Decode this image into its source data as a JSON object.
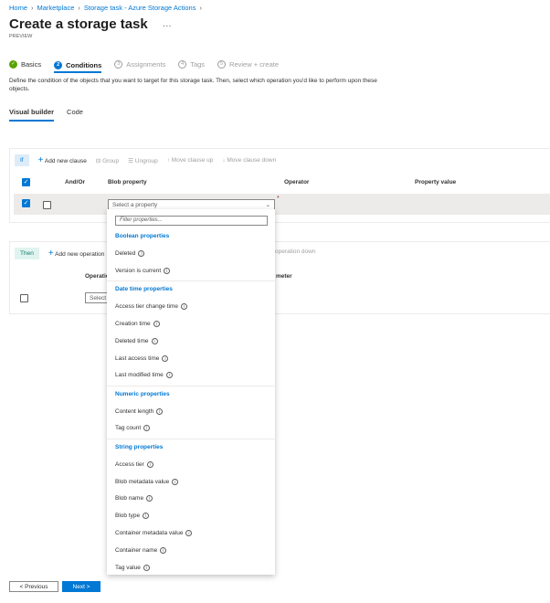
{
  "breadcrumb": [
    "Home",
    "Marketplace",
    "Storage task - Azure Storage Actions"
  ],
  "title": "Create a storage task",
  "more": "···",
  "preview": "PREVIEW",
  "steps": [
    {
      "n": "✓",
      "label": "Basics"
    },
    {
      "n": "2",
      "label": "Conditions"
    },
    {
      "n": "3",
      "label": "Assignments"
    },
    {
      "n": "4",
      "label": "Tags"
    },
    {
      "n": "5",
      "label": "Review + create"
    }
  ],
  "description": "Define the condition of the objects that you want to target for this storage task. Then, select which operation you'd like to perform upon these objects.",
  "tabs": [
    "Visual builder",
    "Code"
  ],
  "if_panel": {
    "tag": "If",
    "toolbar": [
      "Add new clause",
      "Group",
      "Ungroup",
      "Move clause up",
      "Move clause down"
    ],
    "headers": [
      "And/Or",
      "Blob property",
      "Operator",
      "Property value"
    ],
    "select_placeholder": "Select a property",
    "required": "*"
  },
  "then_panel": {
    "tag": "Then",
    "toolbar": [
      "Add new operation",
      "operation down"
    ],
    "headers": [
      "Operatio",
      "meter"
    ],
    "select_placeholder": "Select a"
  },
  "dropdown": {
    "filter_placeholder": "Filter properties...",
    "groups": [
      {
        "header": "Boolean properties",
        "items": [
          "Deleted",
          "Version is current"
        ]
      },
      {
        "header": "Date time properties",
        "items": [
          "Access tier change time",
          "Creation time",
          "Deleted time",
          "Last access time",
          "Last modified time"
        ]
      },
      {
        "header": "Numeric properties",
        "items": [
          "Content length",
          "Tag count"
        ]
      },
      {
        "header": "String properties",
        "items": [
          "Access tier",
          "Blob metadata value",
          "Blob name",
          "Blob type",
          "Container metadata value",
          "Container name",
          "Tag value"
        ]
      }
    ]
  },
  "footer": {
    "previous": "< Previous",
    "next": "Next >"
  }
}
